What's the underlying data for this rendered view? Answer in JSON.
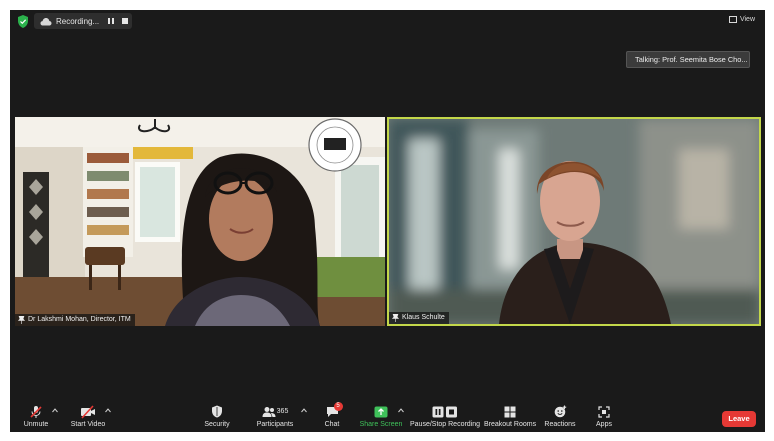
{
  "top_bar": {
    "recording_label": "Recording...",
    "view_label": "View"
  },
  "speaker": {
    "talking_text": "Talking: Prof. Seemita Bose Cho..."
  },
  "tiles": [
    {
      "name": "Dr Lakshmi Mohan, Director, ITM"
    },
    {
      "name": "Klaus Schulte"
    }
  ],
  "toolbar": {
    "unmute": "Unmute",
    "start_video": "Start Video",
    "security": "Security",
    "participants": "Participants",
    "participants_count": "365",
    "chat": "Chat",
    "chat_badge": "5",
    "share_screen": "Share Screen",
    "pause_stop_recording": "Pause/Stop Recording",
    "breakout_rooms": "Breakout Rooms",
    "reactions": "Reactions",
    "apps": "Apps",
    "leave": "Leave"
  },
  "colors": {
    "background": "#1a1a1a",
    "active_speaker_border": "#c3d74a",
    "share_green": "#3fc15a",
    "leave_red": "#e53935"
  }
}
